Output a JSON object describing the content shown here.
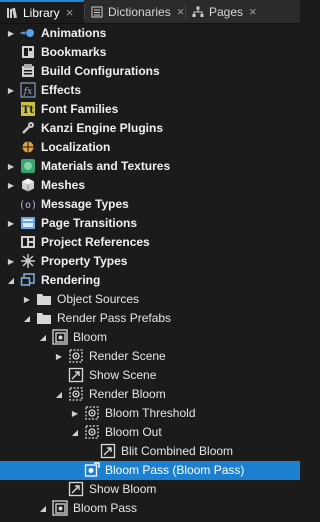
{
  "tabs": [
    {
      "label": "Library",
      "icon": "library-icon",
      "active": true
    },
    {
      "label": "Dictionaries",
      "icon": "dictionaries-icon",
      "active": false
    },
    {
      "label": "Pages",
      "icon": "pages-icon",
      "active": false
    }
  ],
  "tab_close_glyph": "×",
  "colors": {
    "background": "#1b1b1b",
    "selection": "#1c7fcf",
    "tab_accent": "#1e88d8"
  },
  "tree": [
    {
      "label": "Animations",
      "icon": "animations-icon",
      "expander": "collapsed",
      "bold": true
    },
    {
      "label": "Bookmarks",
      "icon": "bookmarks-icon",
      "expander": "none",
      "bold": true
    },
    {
      "label": "Build Configurations",
      "icon": "build-configurations-icon",
      "expander": "none",
      "bold": true
    },
    {
      "label": "Effects",
      "icon": "effects-icon",
      "expander": "collapsed",
      "bold": true
    },
    {
      "label": "Font Families",
      "icon": "font-families-icon",
      "expander": "none",
      "bold": true
    },
    {
      "label": "Kanzi Engine Plugins",
      "icon": "plugins-icon",
      "expander": "none",
      "bold": true
    },
    {
      "label": "Localization",
      "icon": "localization-icon",
      "expander": "none",
      "bold": true
    },
    {
      "label": "Materials and Textures",
      "icon": "materials-icon",
      "expander": "collapsed",
      "bold": true
    },
    {
      "label": "Meshes",
      "icon": "meshes-icon",
      "expander": "collapsed",
      "bold": true
    },
    {
      "label": "Message Types",
      "icon": "message-types-icon",
      "expander": "none",
      "bold": true
    },
    {
      "label": "Page Transitions",
      "icon": "page-transitions-icon",
      "expander": "collapsed",
      "bold": true
    },
    {
      "label": "Project References",
      "icon": "project-references-icon",
      "expander": "none",
      "bold": true
    },
    {
      "label": "Property Types",
      "icon": "property-types-icon",
      "expander": "collapsed",
      "bold": true
    },
    {
      "label": "Rendering",
      "icon": "rendering-icon",
      "expander": "expanded",
      "bold": true
    },
    {
      "label": "Object Sources",
      "icon": "folder-icon",
      "expander": "collapsed",
      "bold": false
    },
    {
      "label": "Render Pass Prefabs",
      "icon": "folder-icon",
      "expander": "expanded",
      "bold": false
    },
    {
      "label": "Bloom",
      "icon": "render-pass-prefab-icon",
      "expander": "expanded",
      "bold": false
    },
    {
      "label": "Render Scene",
      "icon": "render-pass-icon",
      "expander": "collapsed",
      "bold": false
    },
    {
      "label": "Show Scene",
      "icon": "blit-pass-icon",
      "expander": "none",
      "bold": false
    },
    {
      "label": "Render Bloom",
      "icon": "render-pass-icon",
      "expander": "expanded",
      "bold": false
    },
    {
      "label": "Bloom Threshold",
      "icon": "render-pass-icon",
      "expander": "collapsed",
      "bold": false
    },
    {
      "label": "Bloom Out",
      "icon": "render-pass-icon",
      "expander": "expanded",
      "bold": false
    },
    {
      "label": "Blit Combined Bloom",
      "icon": "blit-pass-icon",
      "expander": "none",
      "bold": false
    },
    {
      "label": "Bloom Pass (Bloom Pass)",
      "icon": "bloom-pass-icon",
      "expander": "none",
      "bold": false,
      "selected": true
    },
    {
      "label": "Show Bloom",
      "icon": "blit-pass-icon",
      "expander": "none",
      "bold": false
    },
    {
      "label": "Bloom Pass",
      "icon": "render-pass-prefab-icon",
      "expander": "expanded",
      "bold": false
    }
  ]
}
